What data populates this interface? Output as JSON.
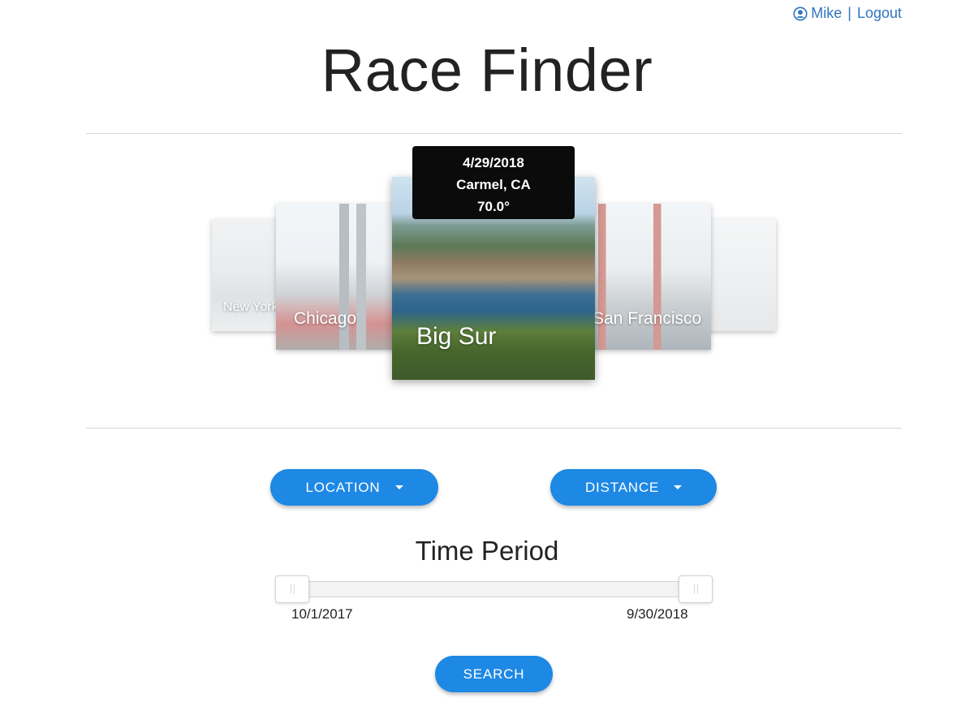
{
  "header": {
    "user_name": "Mike",
    "separator": "|",
    "logout_label": "Logout",
    "user_icon": "user-circle-icon"
  },
  "page": {
    "title": "Race Finder"
  },
  "carousel": {
    "cards": [
      {
        "label": "New York"
      },
      {
        "label": "Chicago"
      },
      {
        "label": "Big Sur"
      },
      {
        "label": "San Francisco"
      },
      {
        "label": ""
      }
    ],
    "tooltip": {
      "date": "4/29/2018",
      "location": "Carmel, CA",
      "temperature": "70.0°"
    }
  },
  "filters": {
    "location_label": "LOCATION",
    "distance_label": "DISTANCE",
    "caret_icon": "caret-down-icon"
  },
  "time_period": {
    "title": "Time Period",
    "start": "10/1/2017",
    "end": "9/30/2018"
  },
  "search": {
    "label": "SEARCH"
  },
  "colors": {
    "accent": "#1e88e5",
    "link": "#2f74c0"
  }
}
